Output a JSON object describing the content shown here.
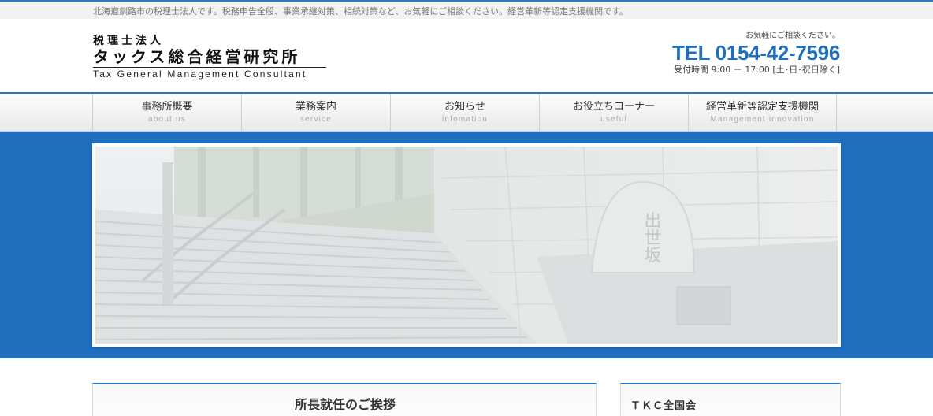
{
  "top_bar": {
    "tagline": "北海道釧路市の税理士法人です。税務申告全般、事業承継対策、相続対策など、お気軽にご相談ください。経営革新等認定支援機関です。"
  },
  "logo": {
    "line1": "税理士法人",
    "line2": "タックス総合経営研究所",
    "line3": "Tax General Management Consultant"
  },
  "contact": {
    "note": "お気軽にご相談ください。",
    "tel": "TEL 0154-42-7596",
    "hours": "受付時間 9:00 － 17:00 [土･日･祝日除く]"
  },
  "nav": {
    "items": [
      {
        "label": "事務所概要",
        "sub": "about us"
      },
      {
        "label": "業務案内",
        "sub": "service"
      },
      {
        "label": "お知らせ",
        "sub": "infomation"
      },
      {
        "label": "お役立ちコーナー",
        "sub": "useful"
      },
      {
        "label": "経営革新等認定支援機関",
        "sub": "Management innovation"
      }
    ]
  },
  "hero": {
    "stone_text": "出世坂"
  },
  "main": {
    "title": "所長就任のご挨拶"
  },
  "sidebar": {
    "title": "ＴＫＣ全国会"
  },
  "colors": {
    "accent": "#1f6fbd",
    "tel": "#1f6fbd"
  }
}
